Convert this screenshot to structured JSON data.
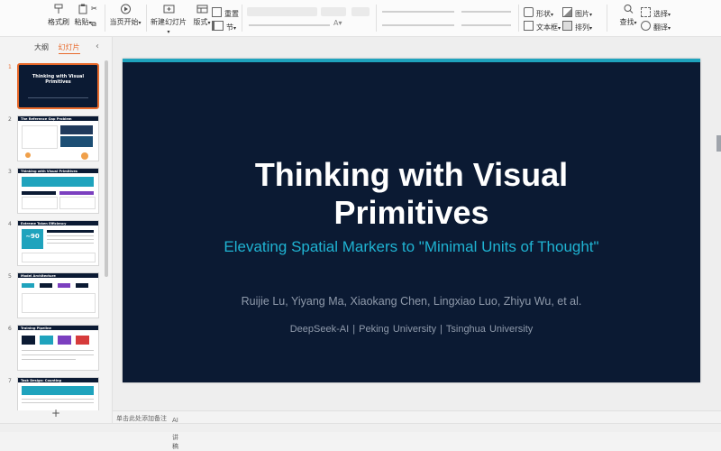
{
  "ribbon": {
    "format_painter": "格式刷",
    "paste": "粘贴",
    "play_from_current": "当页开始",
    "new_slide": "新建幻灯片",
    "layout": "版式",
    "reset": "重置",
    "section": "节",
    "shape": "形状",
    "textbox": "文本框",
    "picture": "图片",
    "arrange": "排列",
    "find": "查找",
    "select": "选择",
    "translate": "翻译"
  },
  "left_pane": {
    "tab_outline": "大纲",
    "tab_slides": "幻灯片",
    "slides": [
      {
        "num": "1",
        "title": "Thinking with Visual Primitives"
      },
      {
        "num": "2",
        "title": "The Reference Gap Problem"
      },
      {
        "num": "3",
        "title": "Thinking with Visual Primitives"
      },
      {
        "num": "4",
        "title": "Extreme Token Efficiency"
      },
      {
        "num": "5",
        "title": "Model Architecture"
      },
      {
        "num": "6",
        "title": "Training Pipeline"
      },
      {
        "num": "7",
        "title": "Task Design: Counting"
      }
    ],
    "thumb4_big": "~90"
  },
  "slide": {
    "title_line1": "Thinking with Visual",
    "title_line2": "Primitives",
    "subtitle": "Elevating Spatial Markers to \"Minimal Units of Thought\"",
    "authors": "Ruijie Lu, Yiyang Ma, Xiaokang Chen, Lingxiao Luo, Zhiyu Wu, et al.",
    "affiliations": "DeepSeek-AI  |  Peking University  |  Tsinghua University"
  },
  "notes": {
    "placeholder": "单击此处添加备注",
    "ai_notes": "AI 演讲稿"
  },
  "colors": {
    "slide_bg": "#0b1a33",
    "accent_teal": "#1fa3bd",
    "selection_orange": "#e8692a"
  }
}
